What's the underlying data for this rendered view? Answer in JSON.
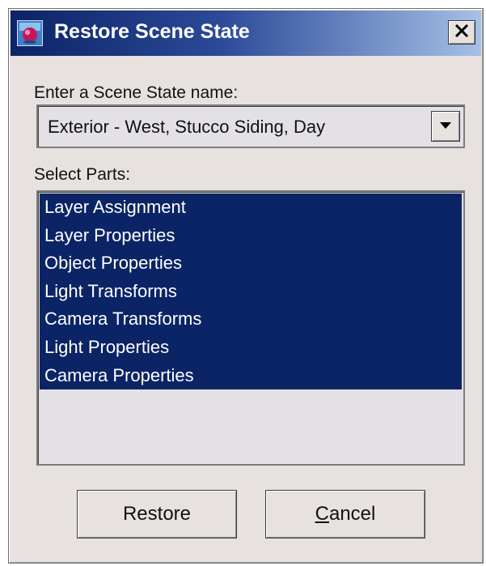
{
  "window": {
    "title": "Restore Scene State",
    "icon": "app-icon",
    "close_icon": "close-icon"
  },
  "scene_state": {
    "label": "Enter a Scene State name:",
    "selected_value": "Exterior - West, Stucco Siding,  Day",
    "dropdown_icon": "chevron-down-icon"
  },
  "parts": {
    "label": "Select Parts:",
    "items": [
      {
        "label": "Layer Assignment",
        "selected": true
      },
      {
        "label": "Layer Properties",
        "selected": true
      },
      {
        "label": "Object Properties",
        "selected": true
      },
      {
        "label": "Light Transforms",
        "selected": true
      },
      {
        "label": "Camera Transforms",
        "selected": true
      },
      {
        "label": "Light Properties",
        "selected": true
      },
      {
        "label": "Camera Properties",
        "selected": true
      }
    ]
  },
  "buttons": {
    "restore": "Restore",
    "cancel_mnemonic": "C",
    "cancel_rest": "ancel"
  },
  "colors": {
    "dialog_bg": "#e7e2df",
    "selection": "#0b2466",
    "title_gradient_start": "#0b2466",
    "title_gradient_end": "#a6c0e6"
  }
}
